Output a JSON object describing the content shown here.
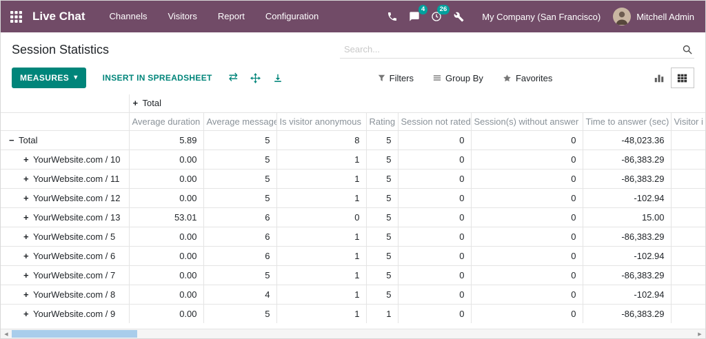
{
  "colors": {
    "top_bar": "#714B67",
    "accent": "#00857A",
    "badge": "#00A09D",
    "scrollbar_thumb": "#a9cdeb"
  },
  "top_bar": {
    "app_name": "Live Chat",
    "menu_items": [
      {
        "label": "Channels"
      },
      {
        "label": "Visitors"
      },
      {
        "label": "Report"
      },
      {
        "label": "Configuration"
      }
    ],
    "messages_badge": "4",
    "activities_badge": "26",
    "company": "My Company (San Francisco)",
    "user_name": "Mitchell Admin"
  },
  "breadcrumb": {
    "title": "Session Statistics"
  },
  "search": {
    "placeholder": "Search..."
  },
  "control_panel": {
    "measures": "MEASURES",
    "insert_in_spreadsheet": "INSERT IN SPREADSHEET",
    "filters": "Filters",
    "group_by": "Group By",
    "favorites": "Favorites"
  },
  "pivot": {
    "column_group": "Total",
    "measures": [
      "Average duration",
      "Average message",
      "Is visitor anonymous",
      "Rating",
      "Session not rated",
      "Session(s) without answer",
      "Time to answer (sec)",
      "Visitor i"
    ],
    "rows": [
      {
        "label": "Total",
        "toggle": "minus",
        "level": 0,
        "values": [
          "5.89",
          "5",
          "8",
          "5",
          "0",
          "0",
          "-48,023.36",
          ""
        ]
      },
      {
        "label": "YourWebsite.com / 10",
        "toggle": "plus",
        "level": 1,
        "values": [
          "0.00",
          "5",
          "1",
          "5",
          "0",
          "0",
          "-86,383.29",
          ""
        ]
      },
      {
        "label": "YourWebsite.com / 11",
        "toggle": "plus",
        "level": 1,
        "values": [
          "0.00",
          "5",
          "1",
          "5",
          "0",
          "0",
          "-86,383.29",
          ""
        ]
      },
      {
        "label": "YourWebsite.com / 12",
        "toggle": "plus",
        "level": 1,
        "values": [
          "0.00",
          "5",
          "1",
          "5",
          "0",
          "0",
          "-102.94",
          ""
        ]
      },
      {
        "label": "YourWebsite.com / 13",
        "toggle": "plus",
        "level": 1,
        "values": [
          "53.01",
          "6",
          "0",
          "5",
          "0",
          "0",
          "15.00",
          ""
        ]
      },
      {
        "label": "YourWebsite.com / 5",
        "toggle": "plus",
        "level": 1,
        "values": [
          "0.00",
          "6",
          "1",
          "5",
          "0",
          "0",
          "-86,383.29",
          ""
        ]
      },
      {
        "label": "YourWebsite.com / 6",
        "toggle": "plus",
        "level": 1,
        "values": [
          "0.00",
          "6",
          "1",
          "5",
          "0",
          "0",
          "-102.94",
          ""
        ]
      },
      {
        "label": "YourWebsite.com / 7",
        "toggle": "plus",
        "level": 1,
        "values": [
          "0.00",
          "5",
          "1",
          "5",
          "0",
          "0",
          "-86,383.29",
          ""
        ]
      },
      {
        "label": "YourWebsite.com / 8",
        "toggle": "plus",
        "level": 1,
        "values": [
          "0.00",
          "4",
          "1",
          "5",
          "0",
          "0",
          "-102.94",
          ""
        ]
      },
      {
        "label": "YourWebsite.com / 9",
        "toggle": "plus",
        "level": 1,
        "values": [
          "0.00",
          "5",
          "1",
          "1",
          "0",
          "0",
          "-86,383.29",
          ""
        ]
      }
    ]
  }
}
